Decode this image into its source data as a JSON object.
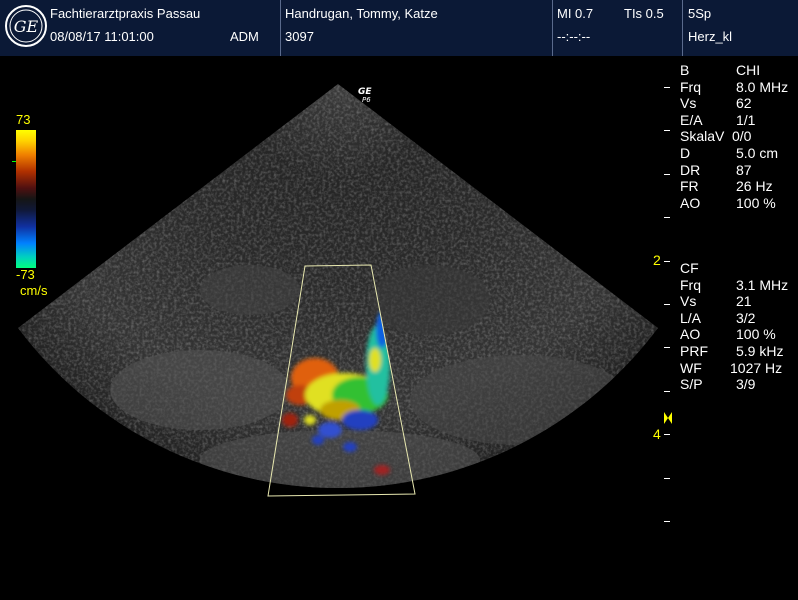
{
  "header": {
    "logo_text": "GE",
    "clinic": "Fachtierarztpraxis Passau",
    "datetime": "08/08/17 11:01:00",
    "operator": "ADM",
    "patient": "Handrugan, Tommy, Katze",
    "patient_id": "3097",
    "mi": "MI 0.7",
    "tis": "TIs 0.5",
    "time_placeholder": "--:--:--",
    "probe": "5Sp",
    "preset": "Herz_kl"
  },
  "probe_mark": {
    "brand": "GE",
    "model": "P6"
  },
  "colorbar": {
    "max": "73",
    "min": "-73",
    "unit": "cm/s"
  },
  "b_mode": {
    "title_k": "B",
    "title_v": "CHI",
    "rows": [
      {
        "k": "Frq",
        "v": "8.0 MHz"
      },
      {
        "k": "Vs",
        "v": "62"
      },
      {
        "k": "E/A",
        "v": "1/1"
      },
      {
        "k": "SkalaV",
        "v": "0/0"
      },
      {
        "k": "D",
        "v": "5.0 cm"
      },
      {
        "k": "DR",
        "v": "87"
      },
      {
        "k": "FR",
        "v": "26 Hz"
      },
      {
        "k": "AO",
        "v": "100 %"
      }
    ]
  },
  "cf_mode": {
    "title_k": "CF",
    "rows": [
      {
        "k": "Frq",
        "v": "3.1 MHz"
      },
      {
        "k": "Vs",
        "v": "21"
      },
      {
        "k": "L/A",
        "v": "3/2"
      },
      {
        "k": "AO",
        "v": "100 %"
      },
      {
        "k": "PRF",
        "v": "5.9 kHz"
      },
      {
        "k": "WF",
        "v": "1027 Hz"
      },
      {
        "k": "S/P",
        "v": "3/9"
      }
    ]
  },
  "depth_scale": {
    "mark_2": "2",
    "mark_4": "4"
  },
  "colors": {
    "header_bg": "#0b1936",
    "accent": "#ffff00"
  }
}
